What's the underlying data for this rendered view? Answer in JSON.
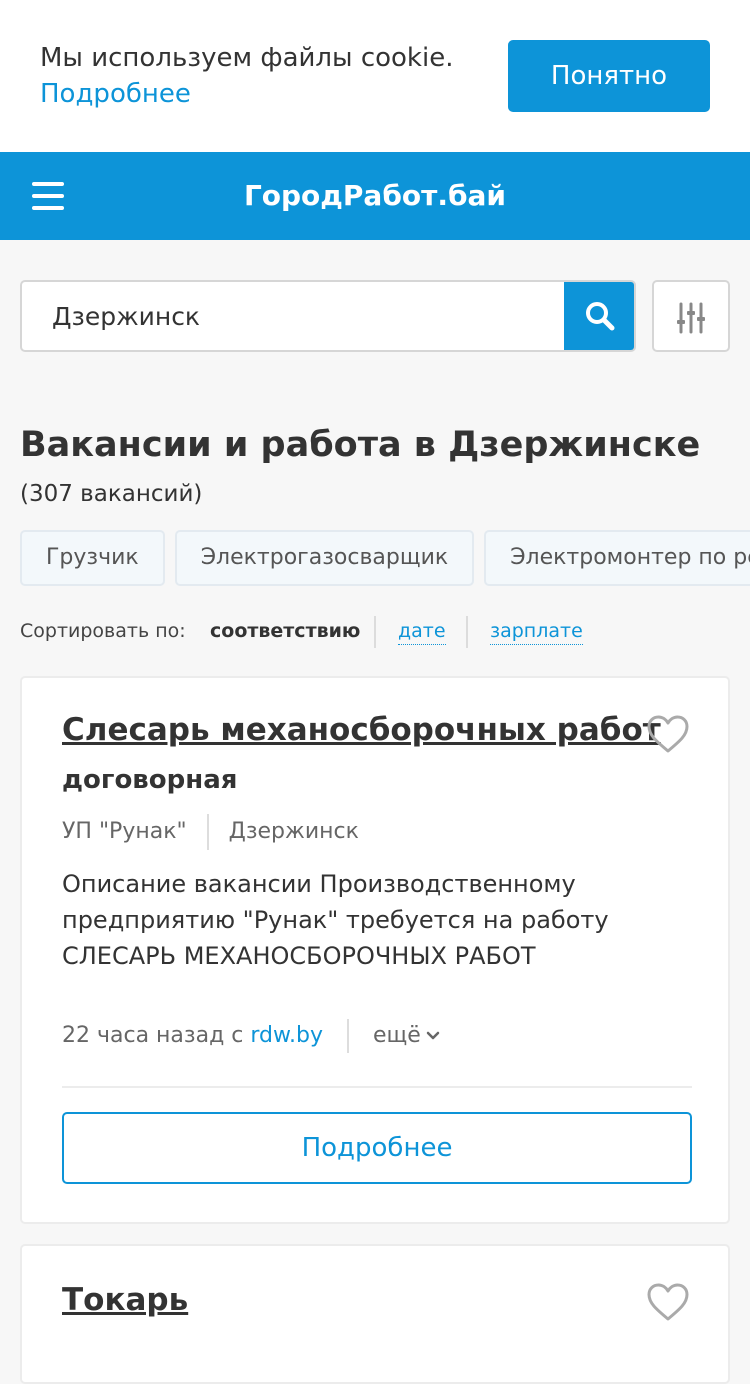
{
  "cookie": {
    "text": "Мы используем файлы cookie.",
    "link": "Подробнее",
    "accept": "Понятно"
  },
  "header": {
    "logo": "ГородРабот.бай"
  },
  "search": {
    "value": "Дзержинск"
  },
  "page": {
    "title": "Вакансии и работа в Дзержинске",
    "count": "(307 вакансий)"
  },
  "tags": [
    "Грузчик",
    "Электрогазосварщик",
    "Электромонтер по ремонту"
  ],
  "sort": {
    "label": "Сортировать по:",
    "options": [
      "соответствию",
      "дате",
      "зарплате"
    ],
    "active": "соответствию"
  },
  "jobs": [
    {
      "title": "Слесарь механосборочных работ",
      "salary": "договорная",
      "company": "УП \"Рунак\"",
      "city": "Дзержинск",
      "description": "Описание вакансии Производственному предприятию \"Рунак\" требуется на работу СЛЕСАРЬ МЕХАНОСБОРОЧНЫХ РАБОТ",
      "posted": "22 часа назад с",
      "source": "rdw.by",
      "more": "ещё",
      "details": "Подробнее"
    },
    {
      "title": "Токарь"
    }
  ],
  "colors": {
    "brand": "#0d94d8",
    "text": "#333333",
    "background": "#f7f7f7"
  },
  "icons": {
    "menu": "hamburger-icon",
    "search": "search-icon",
    "filter": "filter-sliders-icon",
    "favorite": "heart-icon",
    "more": "chevron-down-icon"
  }
}
